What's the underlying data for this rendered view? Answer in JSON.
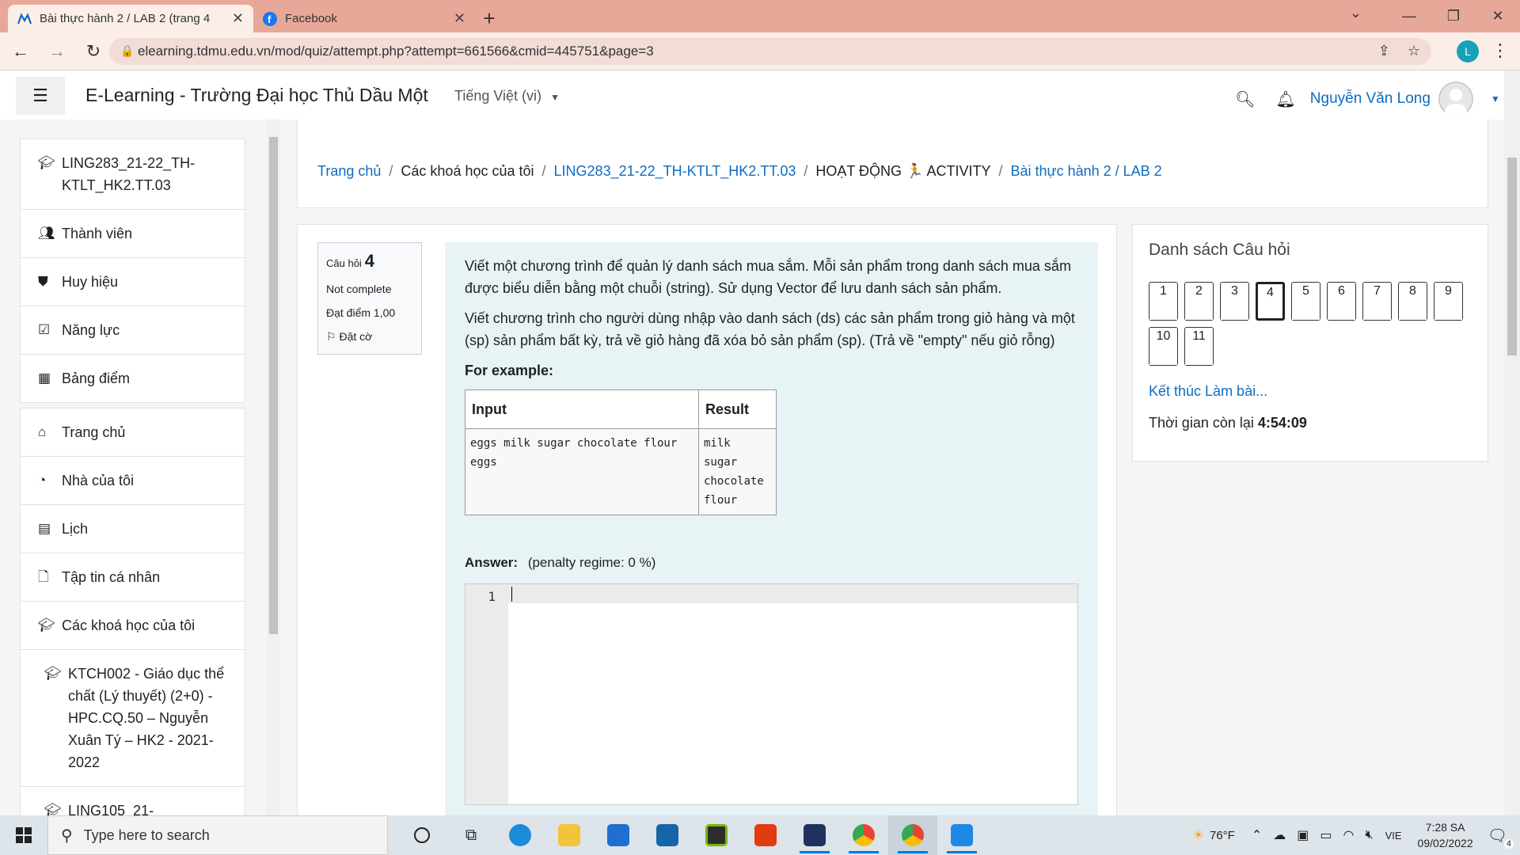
{
  "browser": {
    "tabs": [
      {
        "title": "Bài thực hành 2 / LAB 2 (trang 4"
      },
      {
        "title": "Facebook"
      }
    ],
    "url": "elearning.tdmu.edu.vn/mod/quiz/attempt.php?attempt=661566&cmid=445751&page=3",
    "profile_initial": "L"
  },
  "site": {
    "brand": "E-Learning - Trường Đại học Thủ Dầu Một",
    "language": "Tiếng Việt (vi)",
    "user_name": "Nguyễn Văn Long"
  },
  "drawer": {
    "course_items": [
      {
        "icon": "graduation-cap-icon",
        "label": "LING283_21-22_TH-KTLT_HK2.TT.03"
      },
      {
        "icon": "users-icon",
        "label": "Thành viên"
      },
      {
        "icon": "shield-icon",
        "label": "Huy hiệu"
      },
      {
        "icon": "checkbox-icon",
        "label": "Năng lực"
      },
      {
        "icon": "table-icon",
        "label": "Bảng điểm"
      }
    ],
    "site_items": [
      {
        "icon": "home-icon",
        "label": "Trang chủ"
      },
      {
        "icon": "dashboard-icon",
        "label": "Nhà của tôi"
      },
      {
        "icon": "calendar-icon",
        "label": "Lịch"
      },
      {
        "icon": "file-icon",
        "label": "Tập tin cá nhân"
      },
      {
        "icon": "graduation-cap-icon",
        "label": "Các khoá học của tôi"
      },
      {
        "icon": "graduation-cap-icon",
        "label": "KTCH002 - Giáo dục thể chất (Lý thuyết) (2+0) - HPC.CQ.50 – Nguyễn Xuân Tý – HK2 - 2021-2022"
      },
      {
        "icon": "graduation-cap-icon",
        "label": "LING105_21-"
      }
    ]
  },
  "breadcrumb": [
    {
      "label": "Trang chủ",
      "link": true
    },
    {
      "label": "Các khoá học của tôi",
      "link": false
    },
    {
      "label": "LING283_21-22_TH-KTLT_HK2.TT.03",
      "link": true
    },
    {
      "label": "HOẠT ĐỘNG 🏃 ACTIVITY",
      "link": false
    },
    {
      "label": "Bài thực hành 2 / LAB 2",
      "link": true
    }
  ],
  "question": {
    "label": "Câu hỏi",
    "number": "4",
    "status": "Not complete",
    "grade": "Đạt điểm 1,00",
    "flag": "Đặt cờ",
    "para1": "Viết một chương trình để quản lý danh sách mua sắm. Mỗi sản phẩm trong danh sách mua sắm được biểu diễn bằng một chuỗi (string). Sử dụng Vector để lưu danh sách sản phẩm.",
    "para2": "Viết chương trình cho người dùng nhập vào danh sách (ds) các sản phẩm trong giỏ hàng và một (sp) sản phẩm bất kỳ, trả về giỏ hàng đã xóa bỏ sản phẩm (sp). (Trả về \"empty\" nếu giỏ rỗng)",
    "example_label": "For example:",
    "table_headers": [
      "Input",
      "Result"
    ],
    "table_input": "eggs milk sugar chocolate flour\neggs",
    "table_result": "milk\nsugar\nchocolate\nflour",
    "answer_label": "Answer:",
    "penalty": "(penalty regime: 0 %)",
    "editor_line": "1"
  },
  "quiz_nav": {
    "title": "Danh sách Câu hỏi",
    "questions": [
      "1",
      "2",
      "3",
      "4",
      "5",
      "6",
      "7",
      "8",
      "9",
      "10",
      "11"
    ],
    "current": "4",
    "finish": "Kết thúc Làm bài...",
    "time_label": "Thời gian còn lại",
    "time_value": "4:54:09"
  },
  "taskbar": {
    "search_placeholder": "Type here to search",
    "weather": "76°F",
    "lang": "VIE",
    "time": "7:28 SA",
    "date": "09/02/2022",
    "notif_count": "4"
  }
}
